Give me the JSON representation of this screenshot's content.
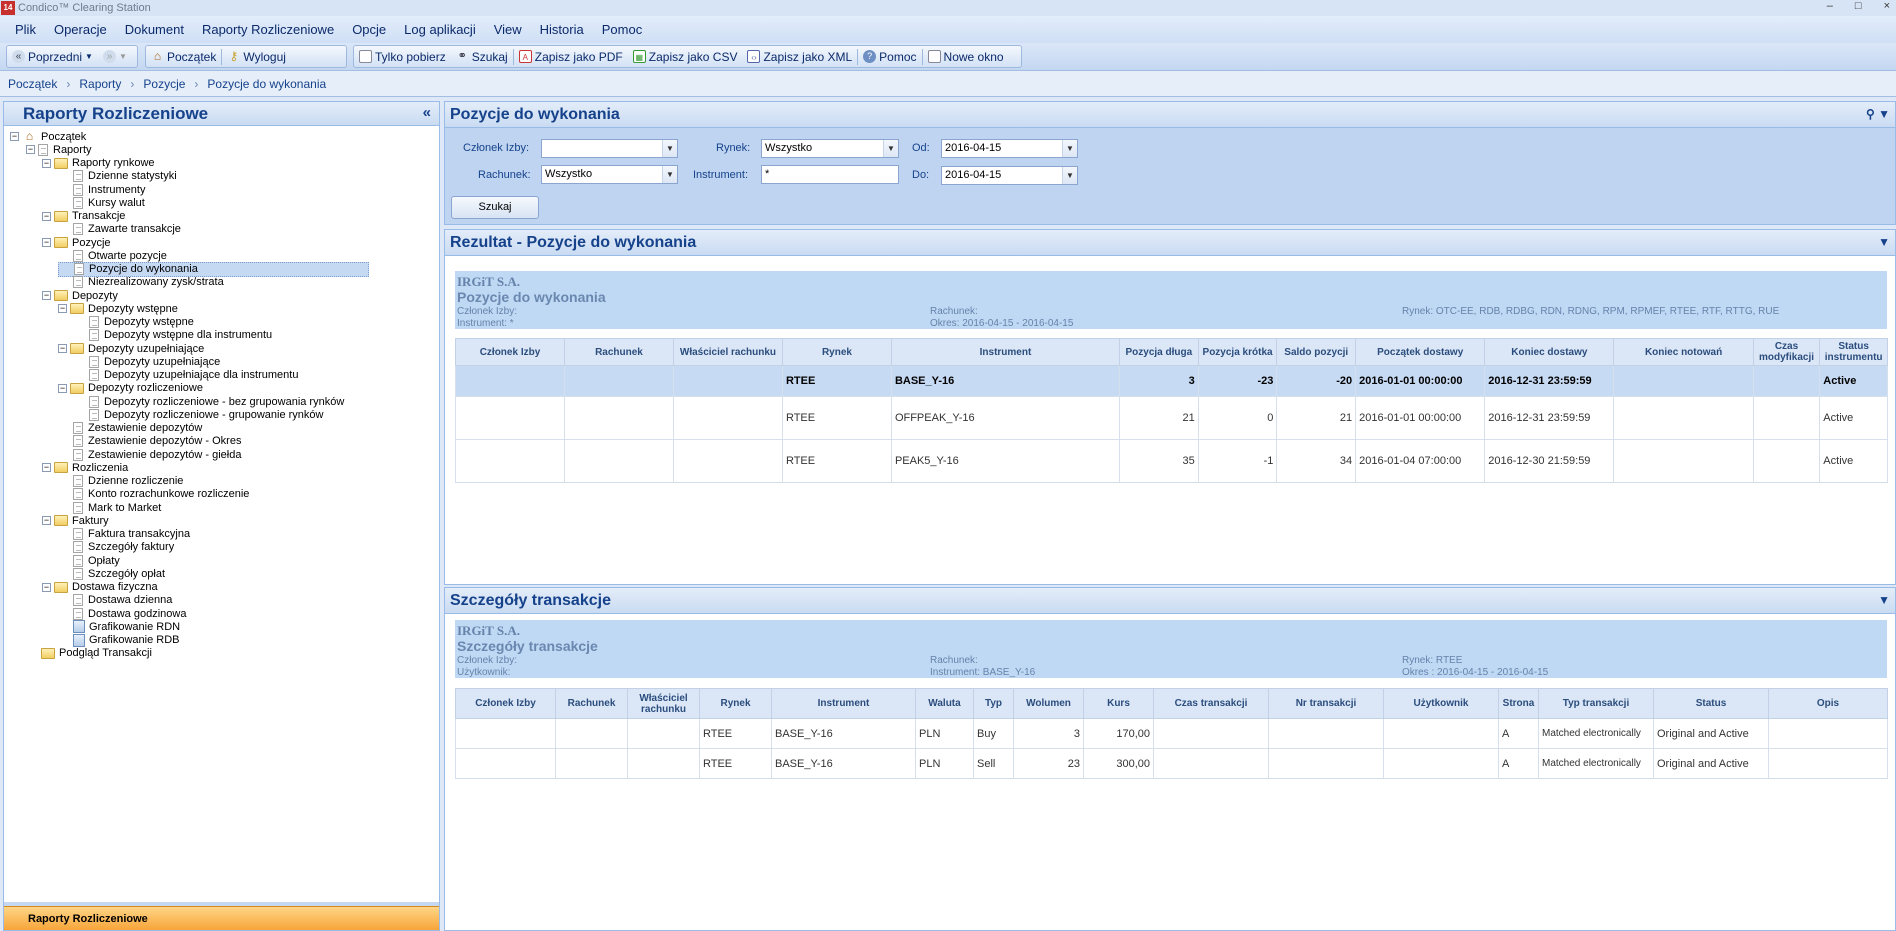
{
  "window": {
    "title": "Condico™ Clearing Station",
    "minimize": "‒",
    "maximize": "□",
    "close": "×"
  },
  "menu": [
    "Plik",
    "Operacje",
    "Dokument",
    "Raporty Rozliczeniowe",
    "Opcje",
    "Log aplikacji",
    "View",
    "Historia",
    "Pomoc"
  ],
  "toolbar": {
    "back": "Poprzedni",
    "home": "Początek",
    "logout": "Wyloguj",
    "download": "Tylko pobierz",
    "search": "Szukaj",
    "pdf": "Zapisz jako PDF",
    "csv": "Zapisz jako CSV",
    "xml": "Zapisz jako XML",
    "help": "Pomoc",
    "new_window": "Nowe okno"
  },
  "breadcrumb": [
    "Początek",
    "Raporty",
    "Pozycje",
    "Pozycje do wykonania"
  ],
  "left_panel": {
    "title": "Raporty Rozliczeniowe",
    "collapse": "«",
    "footer": "Raporty Rozliczeniowe"
  },
  "tree": [
    {
      "label": "Początek"
    },
    {
      "label": "Raporty"
    },
    {
      "label": "Raporty rynkowe"
    },
    {
      "label": "Dzienne statystyki"
    },
    {
      "label": "Instrumenty"
    },
    {
      "label": "Kursy walut"
    },
    {
      "label": "Transakcje"
    },
    {
      "label": "Zawarte transakcje"
    },
    {
      "label": "Pozycje"
    },
    {
      "label": "Otwarte pozycje"
    },
    {
      "label": "Pozycje do wykonania"
    },
    {
      "label": "Niezrealizowany zysk/strata"
    },
    {
      "label": "Depozyty"
    },
    {
      "label": "Depozyty wstępne"
    },
    {
      "label": "Depozyty wstępne"
    },
    {
      "label": "Depozyty wstępne dla instrumentu"
    },
    {
      "label": "Depozyty uzupełniające"
    },
    {
      "label": "Depozyty uzupełniające"
    },
    {
      "label": "Depozyty uzupełniające dla instrumentu"
    },
    {
      "label": "Depozyty rozliczeniowe"
    },
    {
      "label": "Depozyty rozliczeniowe - bez grupowania rynków"
    },
    {
      "label": "Depozyty rozliczeniowe - grupowanie rynków"
    },
    {
      "label": "Zestawienie depozytów"
    },
    {
      "label": "Zestawienie depozytów - Okres"
    },
    {
      "label": "Zestawienie depozytów - giełda"
    },
    {
      "label": "Rozliczenia"
    },
    {
      "label": "Dzienne rozliczenie"
    },
    {
      "label": "Konto rozrachunkowe rozliczenie"
    },
    {
      "label": "Mark to Market"
    },
    {
      "label": "Faktury"
    },
    {
      "label": "Faktura transakcyjna"
    },
    {
      "label": "Szczegóły faktury"
    },
    {
      "label": "Opłaty"
    },
    {
      "label": "Szczegóły opłat"
    },
    {
      "label": "Dostawa fizyczna"
    },
    {
      "label": "Dostawa dzienna"
    },
    {
      "label": "Dostawa godzinowa"
    },
    {
      "label": "Grafikowanie RDN"
    },
    {
      "label": "Grafikowanie RDB"
    },
    {
      "label": "Podgląd Transakcji"
    }
  ],
  "filter_panel": {
    "title": "Pozycje do wykonania",
    "member_label": "Członek Izby:",
    "member_value": "",
    "market_label": "Rynek:",
    "market_value": "Wszystko",
    "from_label": "Od:",
    "from_value": "2016-04-15",
    "account_label": "Rachunek:",
    "account_value": "Wszystko",
    "instrument_label": "Instrument:",
    "instrument_value": "*",
    "to_label": "Do:",
    "to_value": "2016-04-15",
    "search_button": "Szukaj"
  },
  "result_panel": {
    "title": "Rezultat - Pozycje do wykonania",
    "company": "IRGiT S.A.",
    "report_title": "Pozycje do wykonania",
    "member": "Członek Izby:",
    "instrument": "Instrument: *",
    "account": "Rachunek:",
    "period": "Okres: 2016-04-15 - 2016-04-15",
    "market": "Rynek: OTC-EE, RDB, RDBG, RDN, RDNG, RPM, RPMEF, RTEE, RTF, RTTG, RUE",
    "columns": [
      "Członek Izby",
      "Rachunek",
      "Właściciel rachunku",
      "Rynek",
      "Instrument",
      "Pozycja długa",
      "Pozycja krótka",
      "Saldo pozycji",
      "Początek dostawy",
      "Koniec dostawy",
      "Koniec notowań",
      "Czas modyfikacji",
      "Status instrumentu"
    ],
    "rows": [
      [
        "",
        "",
        "",
        "RTEE",
        "BASE_Y-16",
        "3",
        "-23",
        "-20",
        "2016-01-01 00:00:00",
        "2016-12-31 23:59:59",
        "",
        "",
        "Active"
      ],
      [
        "",
        "",
        "",
        "RTEE",
        "OFFPEAK_Y-16",
        "21",
        "0",
        "21",
        "2016-01-01 00:00:00",
        "2016-12-31 23:59:59",
        "",
        "",
        "Active"
      ],
      [
        "",
        "",
        "",
        "RTEE",
        "PEAK5_Y-16",
        "35",
        "-1",
        "34",
        "2016-01-04 07:00:00",
        "2016-12-30 21:59:59",
        "",
        "",
        "Active"
      ]
    ]
  },
  "details_panel": {
    "title": "Szczegóły transakcje",
    "company": "IRGiT S.A.",
    "report_title": "Szczegóły transakcje",
    "member": "Członek Izby:",
    "user": "Użytkownik:",
    "account": "Rachunek:",
    "instrument": "Instrument: BASE_Y-16",
    "market": "Rynek: RTEE",
    "period": "Okres : 2016-04-15 - 2016-04-15",
    "columns": [
      "Członek Izby",
      "Rachunek",
      "Właściciel rachunku",
      "Rynek",
      "Instrument",
      "Waluta",
      "Typ",
      "Wolumen",
      "Kurs",
      "Czas transakcji",
      "Nr transakcji",
      "Użytkownik",
      "Strona",
      "Typ transakcji",
      "Status",
      "Opis"
    ],
    "rows": [
      [
        "",
        "",
        "",
        "RTEE",
        "BASE_Y-16",
        "PLN",
        "Buy",
        "3",
        "170,00",
        "",
        "",
        "",
        "A",
        "Matched electronically",
        "Original and Active",
        ""
      ],
      [
        "",
        "",
        "",
        "RTEE",
        "BASE_Y-16",
        "PLN",
        "Sell",
        "23",
        "300,00",
        "",
        "",
        "",
        "A",
        "Matched electronically",
        "Original and Active",
        ""
      ]
    ]
  },
  "colors": {
    "accent": "#15428b",
    "panel": "#dfe8f6",
    "highlight_row": "#c7daf3",
    "footer": "#f7a53a"
  }
}
